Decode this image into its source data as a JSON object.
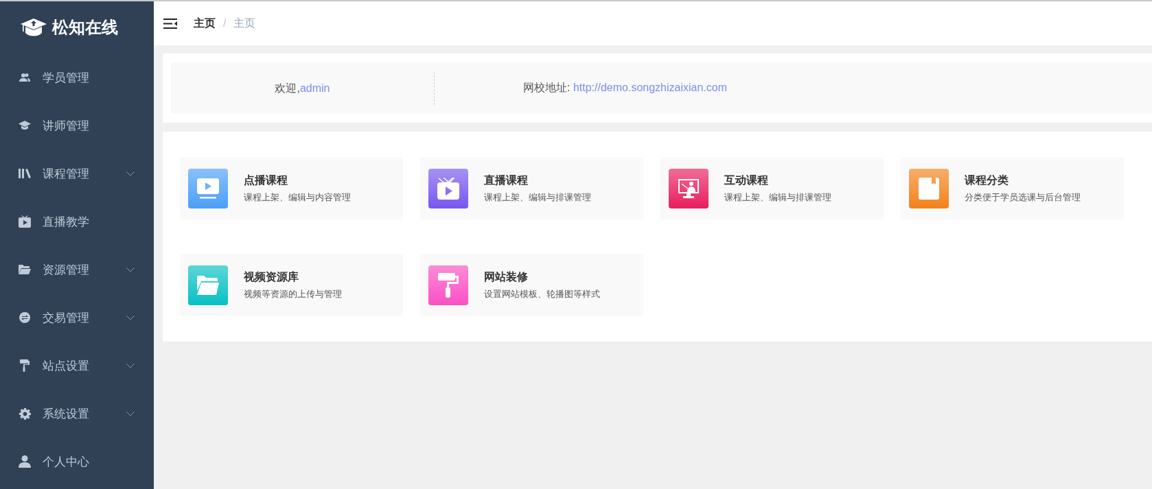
{
  "sidebar": {
    "logo": "松知在线",
    "items": [
      {
        "label": "学员管理",
        "kind": "link"
      },
      {
        "label": "讲师管理",
        "kind": "link"
      },
      {
        "label": "课程管理",
        "kind": "group"
      },
      {
        "label": "直播教学",
        "kind": "link"
      },
      {
        "label": "资源管理",
        "kind": "group"
      },
      {
        "label": "交易管理",
        "kind": "group"
      },
      {
        "label": "站点设置",
        "kind": "group"
      },
      {
        "label": "系统设置",
        "kind": "group"
      },
      {
        "label": "个人中心",
        "kind": "link"
      }
    ]
  },
  "header": {
    "breadcrumb": [
      "主页",
      "主页"
    ],
    "separator": "/"
  },
  "welcome": {
    "greeting": "欢迎,",
    "user": "admin",
    "address_label": "网校地址: ",
    "address": "http://demo.songzhizaixian.com"
  },
  "modules": [
    {
      "title": "点播课程",
      "description": "课程上架、编辑与内容管理",
      "color": "#4a9ff7"
    },
    {
      "title": "直播课程",
      "description": "课程上架、编辑与排课管理",
      "color": "#7757f0"
    },
    {
      "title": "互动课程",
      "description": "课程上架、编辑与排课管理",
      "color": "#e91e5e"
    },
    {
      "title": "课程分类",
      "description": "分类便于学员选课与后台管理",
      "color": "#f2821b"
    },
    {
      "title": "视频资源库",
      "description": "视频等资源的上传与管理",
      "color": "#06c0c4"
    },
    {
      "title": "网站装修",
      "description": "设置网站模板、轮播图等样式",
      "color": "#fb4fc4"
    }
  ]
}
